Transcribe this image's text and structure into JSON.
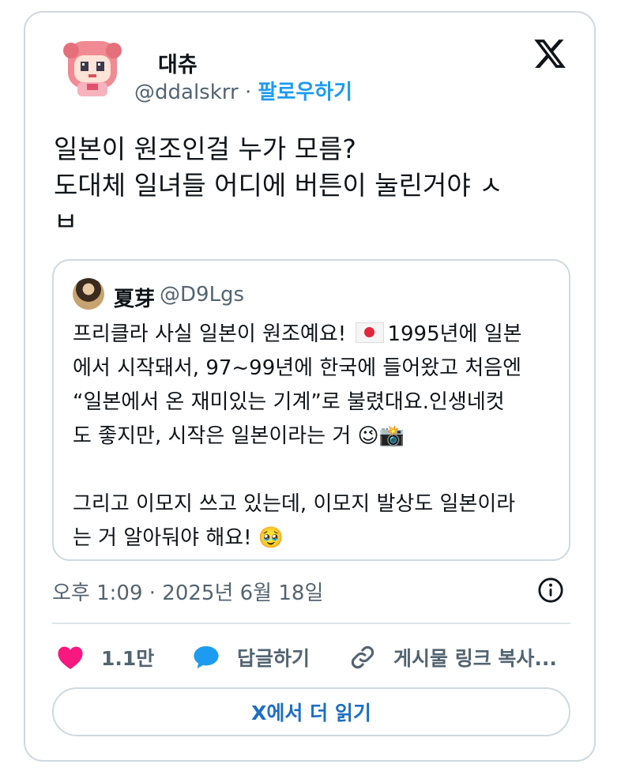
{
  "author": {
    "name": "대츄",
    "handle": "@ddalskrr",
    "separator": " · ",
    "follow_label": "팔로우하기"
  },
  "tweet": {
    "text": "일본이 원조인걸 누가 모름?\n도대체 일녀들 어디에 버튼이 눌린거야 ㅅ\nㅂ"
  },
  "quote": {
    "name": "夏芽",
    "handle": "@D9Lgs",
    "text_part1": "프리클라 사실 일본이 원조예요! ",
    "text_part2": "1995년에 일본\n에서 시작돼서, 97~99년에 한국에 들어왔고 처음엔\n“일본에서 온 재미있는 기계”로 불렸대요.인생네컷\n도 좋지만, 시작은 일본이라는 거 😉📸\n\n그리고 이모지 쓰고 있는데, 이모지 발상도 일본이라\n는 거 알아둬야 해요! 🥹"
  },
  "timestamp": "오후 1:09 · 2025년 6월 18일",
  "actions": {
    "like_count": "1.1만",
    "reply_label": "답글하기",
    "copy_link_label": "게시물 링크 복사..."
  },
  "read_more_label": "X에서 더 읽기",
  "colors": {
    "accent": "#1d9bf0",
    "like": "#f91880",
    "reply": "#1d9bf0",
    "muted": "#536471",
    "border": "#cfd9de"
  },
  "icons": [
    "x-logo-icon",
    "heart-icon",
    "speech-bubble-icon",
    "link-icon",
    "info-icon",
    "japan-flag-icon"
  ]
}
